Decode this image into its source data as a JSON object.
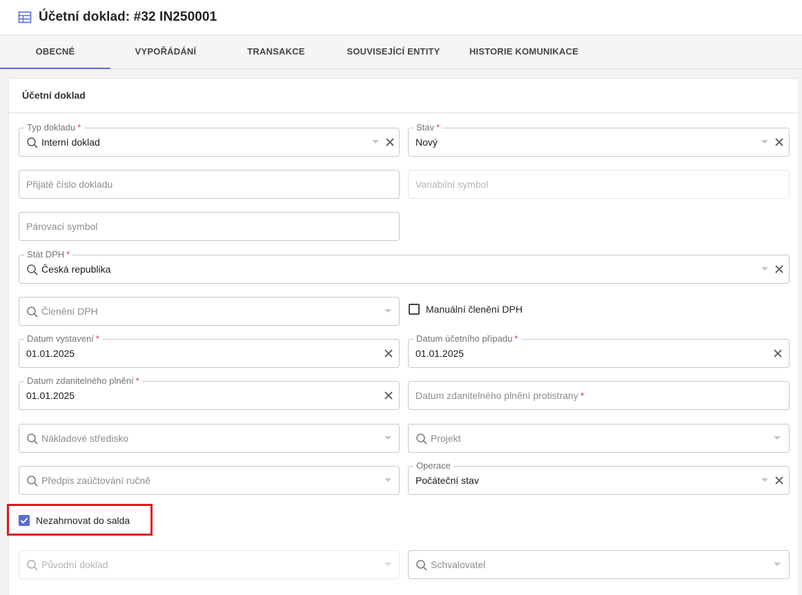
{
  "page": {
    "title": "Účetní doklad: #32 IN250001"
  },
  "tabs": [
    {
      "label": "Obecné"
    },
    {
      "label": "Vypořádání"
    },
    {
      "label": "Transakce"
    },
    {
      "label": "Související entity"
    },
    {
      "label": "Historie komunikace"
    }
  ],
  "card": {
    "title": "Účetní doklad"
  },
  "fields": {
    "typ_dokladu": {
      "label": "Typ dokladu",
      "value": "Interní doklad",
      "required": "*"
    },
    "stav": {
      "label": "Stav",
      "value": "Nový",
      "required": "*"
    },
    "prijate_cislo": {
      "placeholder": "Přijaté číslo dokladu"
    },
    "variabilni_symbol": {
      "placeholder": "Variabilní symbol"
    },
    "parovaci_symbol": {
      "placeholder": "Párovací symbol"
    },
    "stat_dph": {
      "label": "Stát DPH",
      "value": "Česká republika",
      "required": "*"
    },
    "cleneni_dph": {
      "placeholder": "Členění DPH"
    },
    "manualni_cleneni": {
      "label": "Manuální členění DPH",
      "checked": false
    },
    "datum_vystaveni": {
      "label": "Datum vystavení",
      "value": "01.01.2025",
      "required": "*"
    },
    "datum_ucetniho_pripadu": {
      "label": "Datum účetního případu",
      "value": "01.01.2025",
      "required": "*"
    },
    "datum_zdanitelneho_plneni": {
      "label": "Datum zdanitelného plnění",
      "value": "01.01.2025",
      "required": "*"
    },
    "datum_zdanitelneho_plneni_protistrany": {
      "placeholder": "Datum zdanitelného plnění protistrany",
      "required": "*"
    },
    "nakladove_stredisko": {
      "placeholder": "Nákladové středisko"
    },
    "projekt": {
      "placeholder": "Projekt"
    },
    "predpis_zauctovani": {
      "placeholder": "Předpis zaúčtování ručně"
    },
    "operace": {
      "label": "Operace",
      "value": "Počáteční stav"
    },
    "nezahrnovat_do_salda": {
      "label": "Nezahrnovat do salda",
      "checked": true
    },
    "puvodni_doklad": {
      "placeholder": "Původní doklad"
    },
    "schvalovatel": {
      "placeholder": "Schvalovatel"
    }
  },
  "colors": {
    "accent": "#5b6cd8",
    "required": "#e53935",
    "highlight": "#e0161b"
  }
}
